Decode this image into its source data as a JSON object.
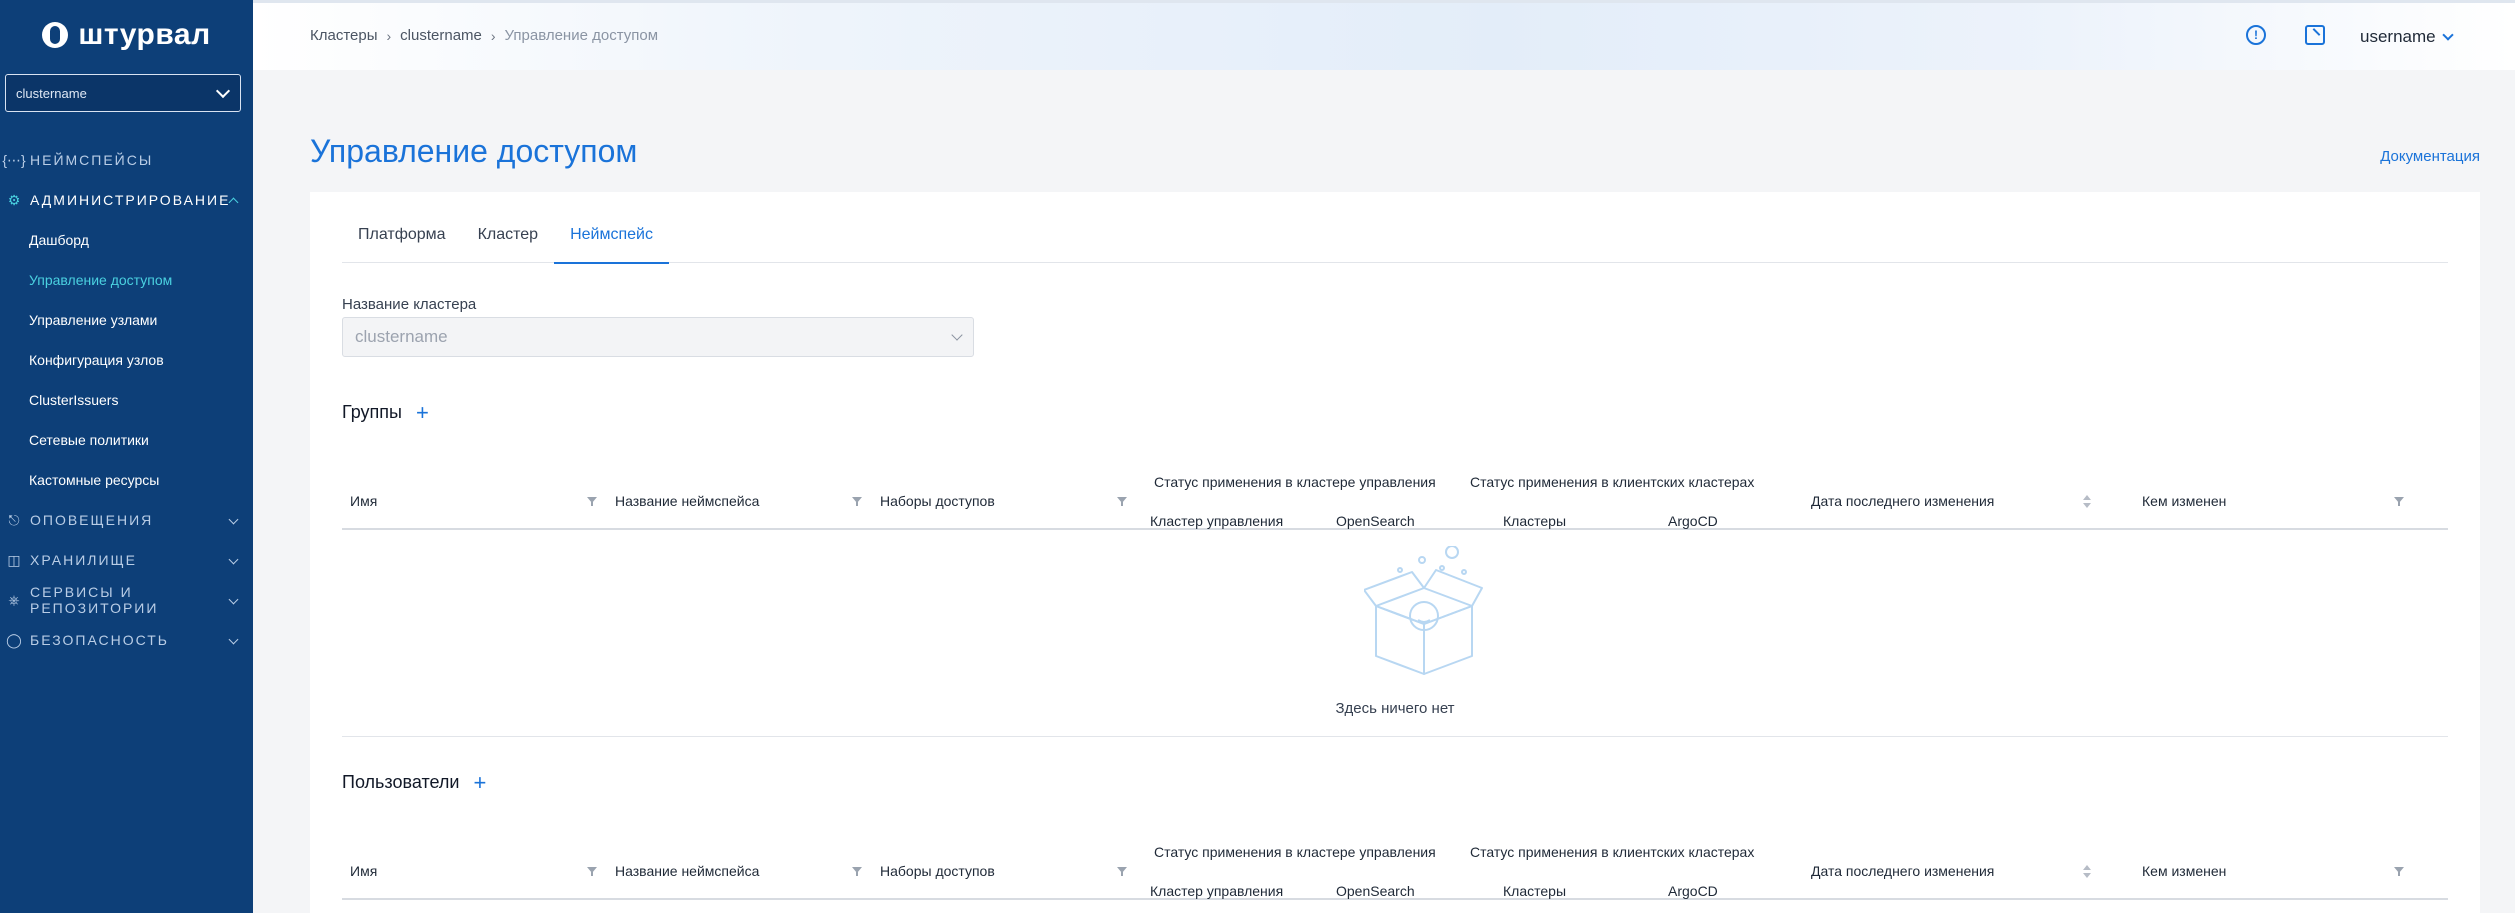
{
  "logo": {
    "text": "штурвал"
  },
  "sidebar": {
    "cluster_select": "clustername",
    "groups": [
      {
        "label": "Неймспейсы",
        "icon": "braces-icon"
      },
      {
        "label": "Администрирование",
        "icon": "gear-icon",
        "items": [
          "Дашборд",
          "Управление доступом",
          "Управление узлами",
          "Конфигурация узлов",
          "ClusterIssuers",
          "Сетевые политики",
          "Кастомные ресурсы"
        ],
        "current": "Управление доступом"
      },
      {
        "label": "Оповещения",
        "icon": "bell-icon"
      },
      {
        "label": "Хранилище",
        "icon": "database-icon"
      },
      {
        "label_line1": "Сервисы и",
        "label_line2": "репозитории",
        "icon": "services-icon"
      },
      {
        "label": "Безопасность",
        "icon": "shield-icon"
      }
    ]
  },
  "header": {
    "breadcrumbs": [
      "Кластеры",
      "clustername",
      "Управление доступом"
    ],
    "info_icon": "!",
    "username": "username"
  },
  "page": {
    "title": "Управление доступом",
    "doc_link": "Документация",
    "tabs": [
      "Платформа",
      "Кластер",
      "Неймспейс"
    ],
    "active_tab": "Неймспейс",
    "cluster_field_label": "Название кластера",
    "cluster_field_value": "clustername"
  },
  "table_headers": {
    "name": "Имя",
    "namespace": "Название неймспейса",
    "access_sets": "Наборы доступов",
    "status_mgmt": "Статус применения в кластере управления",
    "status_client": "Статус применения в клиентских кластерах",
    "mgmt_cluster": "Кластер управления",
    "opensearch": "OpenSearch",
    "clusters": "Кластеры",
    "argocd": "ArgoCD",
    "last_modified": "Дата последнего изменения",
    "modified_by": "Кем изменен"
  },
  "groups_section": {
    "title": "Группы",
    "empty_text": "Здесь ничего нет"
  },
  "users_section": {
    "title": "Пользователи"
  },
  "colors": {
    "sidebar": "#0d3f78",
    "accent": "#1a73d9",
    "active_nav": "#4ad1e0"
  }
}
